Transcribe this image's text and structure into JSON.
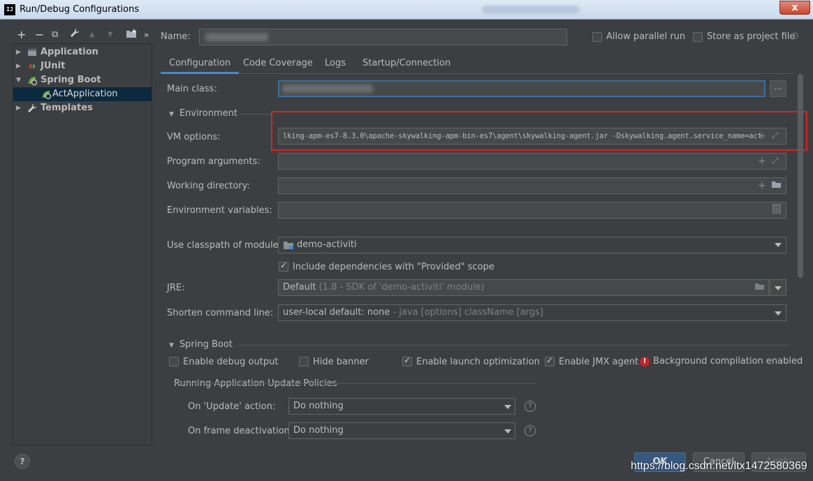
{
  "window": {
    "title": "Run/Debug Configurations",
    "close_glyph": "x",
    "app_icon_text": "IJ"
  },
  "toolbar": {
    "add": "+",
    "remove": "−",
    "copy": "⧉",
    "edit": "🔧",
    "up": "▲",
    "down": "▼",
    "folder": "📁",
    "more": "»"
  },
  "tree": {
    "items": [
      {
        "label": "Application",
        "icon": "application-icon"
      },
      {
        "label": "JUnit",
        "icon": "junit-icon"
      },
      {
        "label": "Spring Boot",
        "icon": "spring-boot-icon"
      },
      {
        "label": "ActApplication",
        "icon": "spring-boot-app-icon"
      },
      {
        "label": "Templates",
        "icon": "wrench-icon"
      }
    ]
  },
  "header": {
    "name_label": "Name:",
    "allow_parallel": "Allow parallel run",
    "store_project": "Store as project file"
  },
  "tabs": [
    "Configuration",
    "Code Coverage",
    "Logs",
    "Startup/Connection"
  ],
  "config": {
    "main_class_label": "Main class:",
    "browse": "...",
    "environment_title": "Environment",
    "vm_label": "VM options:",
    "vm_value": "lking-apm-es7-8.3.0\\apache-skywalking-apm-bin-es7\\agent\\skywalking-agent.jar -Dskywalking.agent.service_name=act",
    "program_args_label": "Program arguments:",
    "working_dir_label": "Working directory:",
    "env_vars_label": "Environment variables:",
    "classpath_label": "Use classpath of module:",
    "classpath_value": "demo-activiti",
    "include_deps": "Include dependencies with \"Provided\" scope",
    "jre_label": "JRE:",
    "jre_value": "Default",
    "jre_hint": "(1.8 - SDK of 'demo-activiti' module)",
    "shorten_label": "Shorten command line:",
    "shorten_value": "user-local default: none",
    "shorten_hint": "- java [options] className [args]"
  },
  "spring_boot": {
    "title": "Spring Boot",
    "enable_debug": "Enable debug output",
    "hide_banner": "Hide banner",
    "enable_launch": "Enable launch optimization",
    "enable_jmx": "Enable JMX agent",
    "bg_compilation": "Background compilation enabled",
    "policies_title": "Running Application Update Policies",
    "on_update_label": "On 'Update' action:",
    "on_update_value": "Do nothing",
    "on_frame_label": "On frame deactivation:",
    "on_frame_value": "Do nothing"
  },
  "buttons": {
    "ok": "OK",
    "cancel": "Cancel",
    "apply": "Apply",
    "help": "?"
  },
  "watermark": "https://blog.csdn.net/ltx1472580369"
}
